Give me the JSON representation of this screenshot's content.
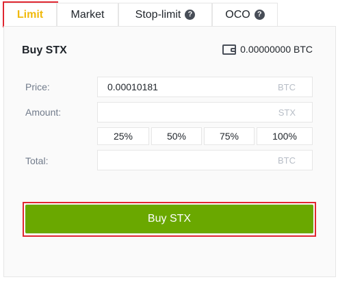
{
  "tabs": [
    {
      "label": "Limit"
    },
    {
      "label": "Market"
    },
    {
      "label": "Stop-limit",
      "icon": "help-icon"
    },
    {
      "label": "OCO",
      "icon": "help-icon"
    }
  ],
  "active_tab": "Limit",
  "form": {
    "title": "Buy STX",
    "balance": "0.00000000 BTC",
    "price_label": "Price:",
    "price_value": "0.00010181",
    "price_unit": "BTC",
    "amount_label": "Amount:",
    "amount_value": "",
    "amount_unit": "STX",
    "percentages": [
      "25%",
      "50%",
      "75%",
      "100%"
    ],
    "total_label": "Total:",
    "total_value": "",
    "total_unit": "BTC",
    "buy_button": "Buy STX"
  },
  "colors": {
    "active_tab": "#f0b90b",
    "buy_button": "#6aa800",
    "highlight": "#e0252f"
  }
}
